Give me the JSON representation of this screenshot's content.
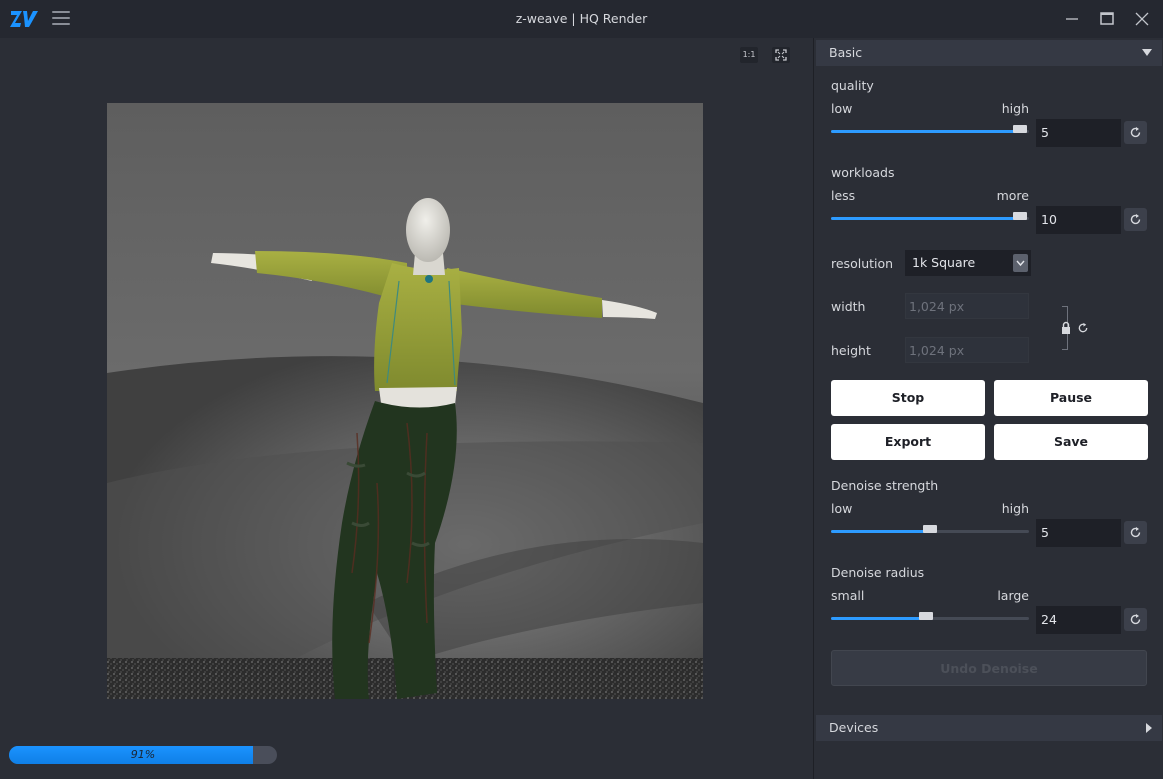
{
  "app": {
    "title": "z-weave | HQ Render",
    "brand_color": "#1b93ff"
  },
  "titlebar": {
    "logo_icon": "zw-logo",
    "menu_icon": "hamburger-icon",
    "controls": [
      "minimize-icon",
      "maximize-icon",
      "close-icon"
    ]
  },
  "viewport": {
    "actual_size_label": "1:1",
    "fit_icon": "fit-screen-icon",
    "render_image": "3D mannequin in olive green cropped long-sleeve top and dark green cargo pants, T-pose, grey studio background",
    "progress": {
      "percent": 91,
      "label": "91%"
    }
  },
  "panel": {
    "basic": {
      "title": "Basic",
      "quality": {
        "label": "quality",
        "min_label": "low",
        "max_label": "high",
        "value": "5",
        "fraction": 0.955
      },
      "workloads": {
        "label": "workloads",
        "min_label": "less",
        "max_label": "more",
        "value": "10",
        "fraction": 0.955
      },
      "resolution": {
        "label": "resolution",
        "selected": "1k Square"
      },
      "width": {
        "label": "width",
        "placeholder": "1,024 px"
      },
      "height": {
        "label": "height",
        "placeholder": "1,024 px"
      },
      "buttons": {
        "stop": "Stop",
        "pause": "Pause",
        "export": "Export",
        "save": "Save"
      },
      "denoise_strength": {
        "label": "Denoise strength",
        "min_label": "low",
        "max_label": "high",
        "value": "5",
        "fraction": 0.5
      },
      "denoise_radius": {
        "label": "Denoise radius",
        "min_label": "small",
        "max_label": "large",
        "value": "24",
        "fraction": 0.48
      },
      "undo_denoise": "Undo Denoise"
    },
    "devices": {
      "title": "Devices"
    }
  }
}
